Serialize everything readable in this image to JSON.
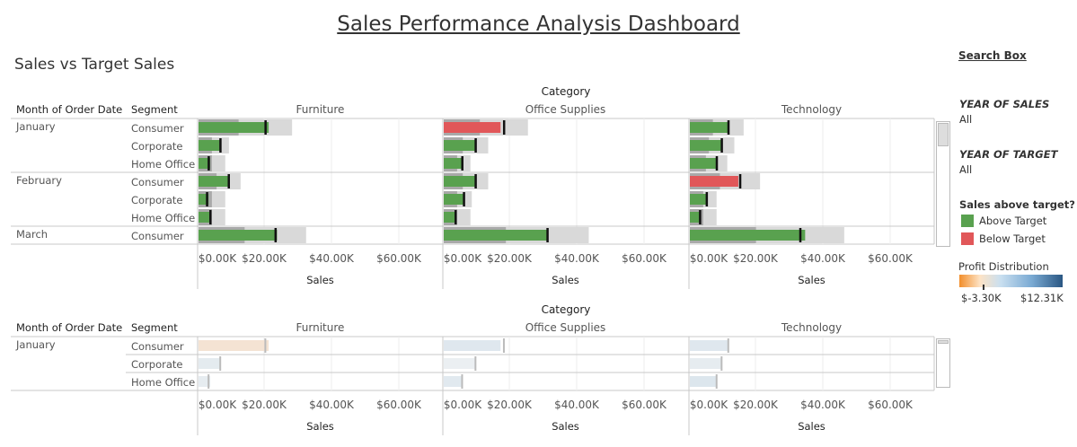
{
  "dashboard": {
    "title": "Sales Performance Analysis Dashboard",
    "subtitle": "Sales vs Target Sales"
  },
  "panels": [
    {
      "category_label": "Category",
      "month_header": "Month of Order Date",
      "segment_header": "Segment",
      "axis_title": "Sales"
    },
    {
      "category_label": "Category",
      "month_header": "Month of Order Date",
      "segment_header": "Segment",
      "axis_title": "Sales"
    }
  ],
  "categories": [
    "Furniture",
    "Office Supplies",
    "Technology"
  ],
  "x_ticks": [
    "$0.00K",
    "$20.00K",
    "$40.00K",
    "$60.00K"
  ],
  "sidebar": {
    "search_label": "Search Box",
    "year_sales_title": "YEAR OF SALES",
    "year_sales_value": "All",
    "year_target_title": "YEAR OF TARGET",
    "year_target_value": "All",
    "legend_title": "Sales above target?",
    "legend_above": "Above Target",
    "legend_below": "Below Target",
    "profit_title": "Profit Distribution",
    "profit_min": "$-3.30K",
    "profit_max": "$12.31K"
  },
  "colors": {
    "above": "#59a14f",
    "below": "#e15759",
    "band_dark": "#a9a9a9",
    "band_light": "#d9d9d9",
    "profit_low": "#f28e2b",
    "profit_high": "#2a5783"
  },
  "chart_data": {
    "type": "bar",
    "subtype": "bullet",
    "xlabel": "Sales",
    "xlim": [
      0,
      70
    ],
    "x_unit": "$K",
    "rows": [
      {
        "month": "January",
        "segment": "Consumer"
      },
      {
        "month": "January",
        "segment": "Corporate"
      },
      {
        "month": "January",
        "segment": "Home Office"
      },
      {
        "month": "February",
        "segment": "Consumer"
      },
      {
        "month": "February",
        "segment": "Corporate"
      },
      {
        "month": "February",
        "segment": "Home Office"
      },
      {
        "month": "March",
        "segment": "Consumer"
      }
    ],
    "series": [
      {
        "category": "Furniture",
        "sales": [
          21,
          6.5,
          3.5,
          9,
          3,
          3.5,
          23.5
        ],
        "target": [
          20,
          6.5,
          3,
          9,
          2.5,
          3.5,
          23
        ]
      },
      {
        "category": "Office Supplies",
        "sales": [
          17,
          9.5,
          5.5,
          9.5,
          6,
          3.5,
          31
        ],
        "target": [
          18,
          9.5,
          5.5,
          9.5,
          6,
          3.5,
          31
        ]
      },
      {
        "category": "Technology",
        "sales": [
          11.5,
          9.5,
          8,
          14.5,
          5,
          3,
          34.5
        ],
        "target": [
          11.5,
          9.5,
          8,
          15,
          5,
          3,
          33
        ]
      }
    ],
    "profit_scale": [
      -3.3,
      12.31
    ],
    "second_panel": {
      "rows": [
        {
          "month": "January",
          "segment": "Consumer"
        },
        {
          "month": "January",
          "segment": "Corporate"
        },
        {
          "month": "January",
          "segment": "Home Office"
        }
      ],
      "series": [
        {
          "category": "Furniture",
          "sales": [
            21,
            6.5,
            3.5
          ],
          "target": [
            20,
            6.5,
            3
          ],
          "profit": [
            -1.5,
            4,
            3
          ]
        },
        {
          "category": "Office Supplies",
          "sales": [
            17,
            9.5,
            5.5
          ],
          "target": [
            18,
            9.5,
            5.5
          ],
          "profit": [
            6,
            1,
            5
          ]
        },
        {
          "category": "Technology",
          "sales": [
            11.5,
            9.5,
            8
          ],
          "target": [
            11.5,
            9.5,
            8
          ],
          "profit": [
            6,
            3,
            7
          ]
        }
      ]
    }
  }
}
